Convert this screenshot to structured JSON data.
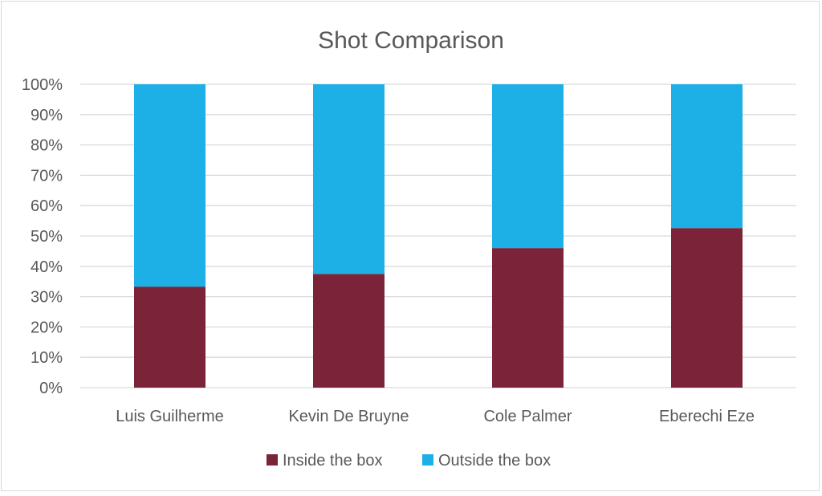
{
  "chart_data": {
    "type": "bar",
    "stacked": "percent",
    "title": "Shot Comparison",
    "xlabel": "",
    "ylabel": "",
    "categories": [
      "Luis Guilherme",
      "Kevin De Bruyne",
      "Cole Palmer",
      "Eberechi Eze"
    ],
    "series": [
      {
        "name": "Inside the box",
        "color": "#7B2439",
        "values": [
          33.3,
          37.5,
          46.0,
          52.6
        ]
      },
      {
        "name": "Outside the box",
        "color": "#1CB0E6",
        "values": [
          66.7,
          62.5,
          54.0,
          47.4
        ]
      }
    ],
    "ylim": [
      0,
      100
    ],
    "yticks": [
      "0%",
      "10%",
      "20%",
      "30%",
      "40%",
      "50%",
      "60%",
      "70%",
      "80%",
      "90%",
      "100%"
    ],
    "grid": true,
    "legend": "bottom"
  }
}
